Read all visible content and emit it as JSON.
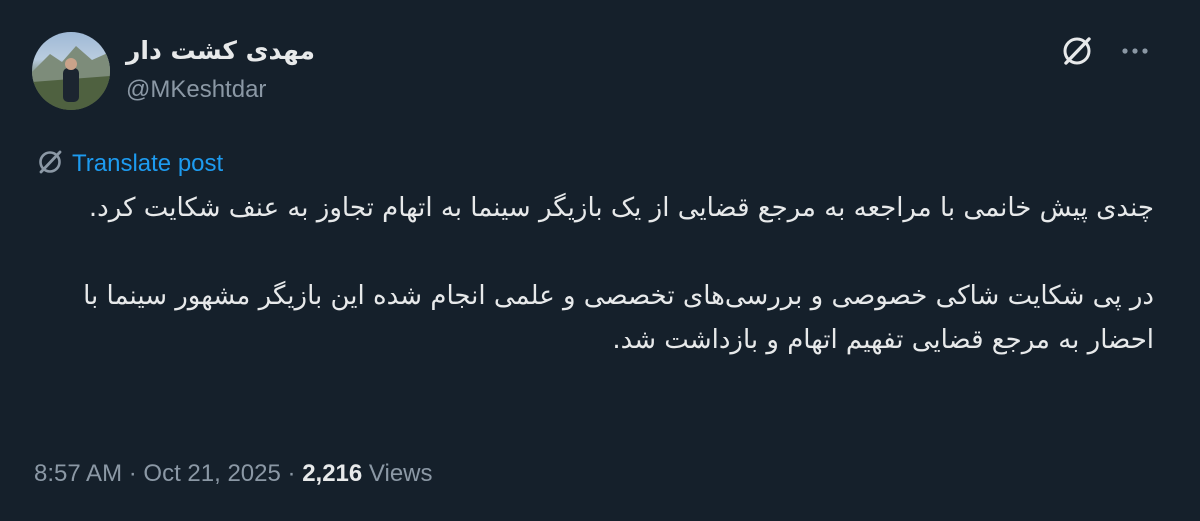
{
  "author": {
    "name": "مهدی کشت دار",
    "handle": "@MKeshtdar"
  },
  "header_icons": [
    "grok-icon",
    "more-options-icon"
  ],
  "translate": {
    "label": "Translate post",
    "icon": "translate-icon"
  },
  "body": {
    "paragraph_1": "چندی پیش خانمی با مراجعه به مرجع قضایی از یک بازیگر سینما به اتهام تجاوز به عنف شکایت کرد.",
    "paragraph_2": "در پی شکایت شاکی خصوصی و بررسی‌های تخصصی و علمی انجام شده این بازیگر مشهور سینما با احضار به مرجع قضایی تفهیم اتهام و بازداشت شد."
  },
  "meta": {
    "time": "8:57 AM",
    "date": "Oct 21, 2025",
    "views_count": "2,216",
    "views_label": "Views",
    "separator": "·"
  },
  "colors": {
    "background": "#15202b",
    "text": "#e7e9ea",
    "secondary": "#8b98a5",
    "accent": "#1d9bf0"
  }
}
